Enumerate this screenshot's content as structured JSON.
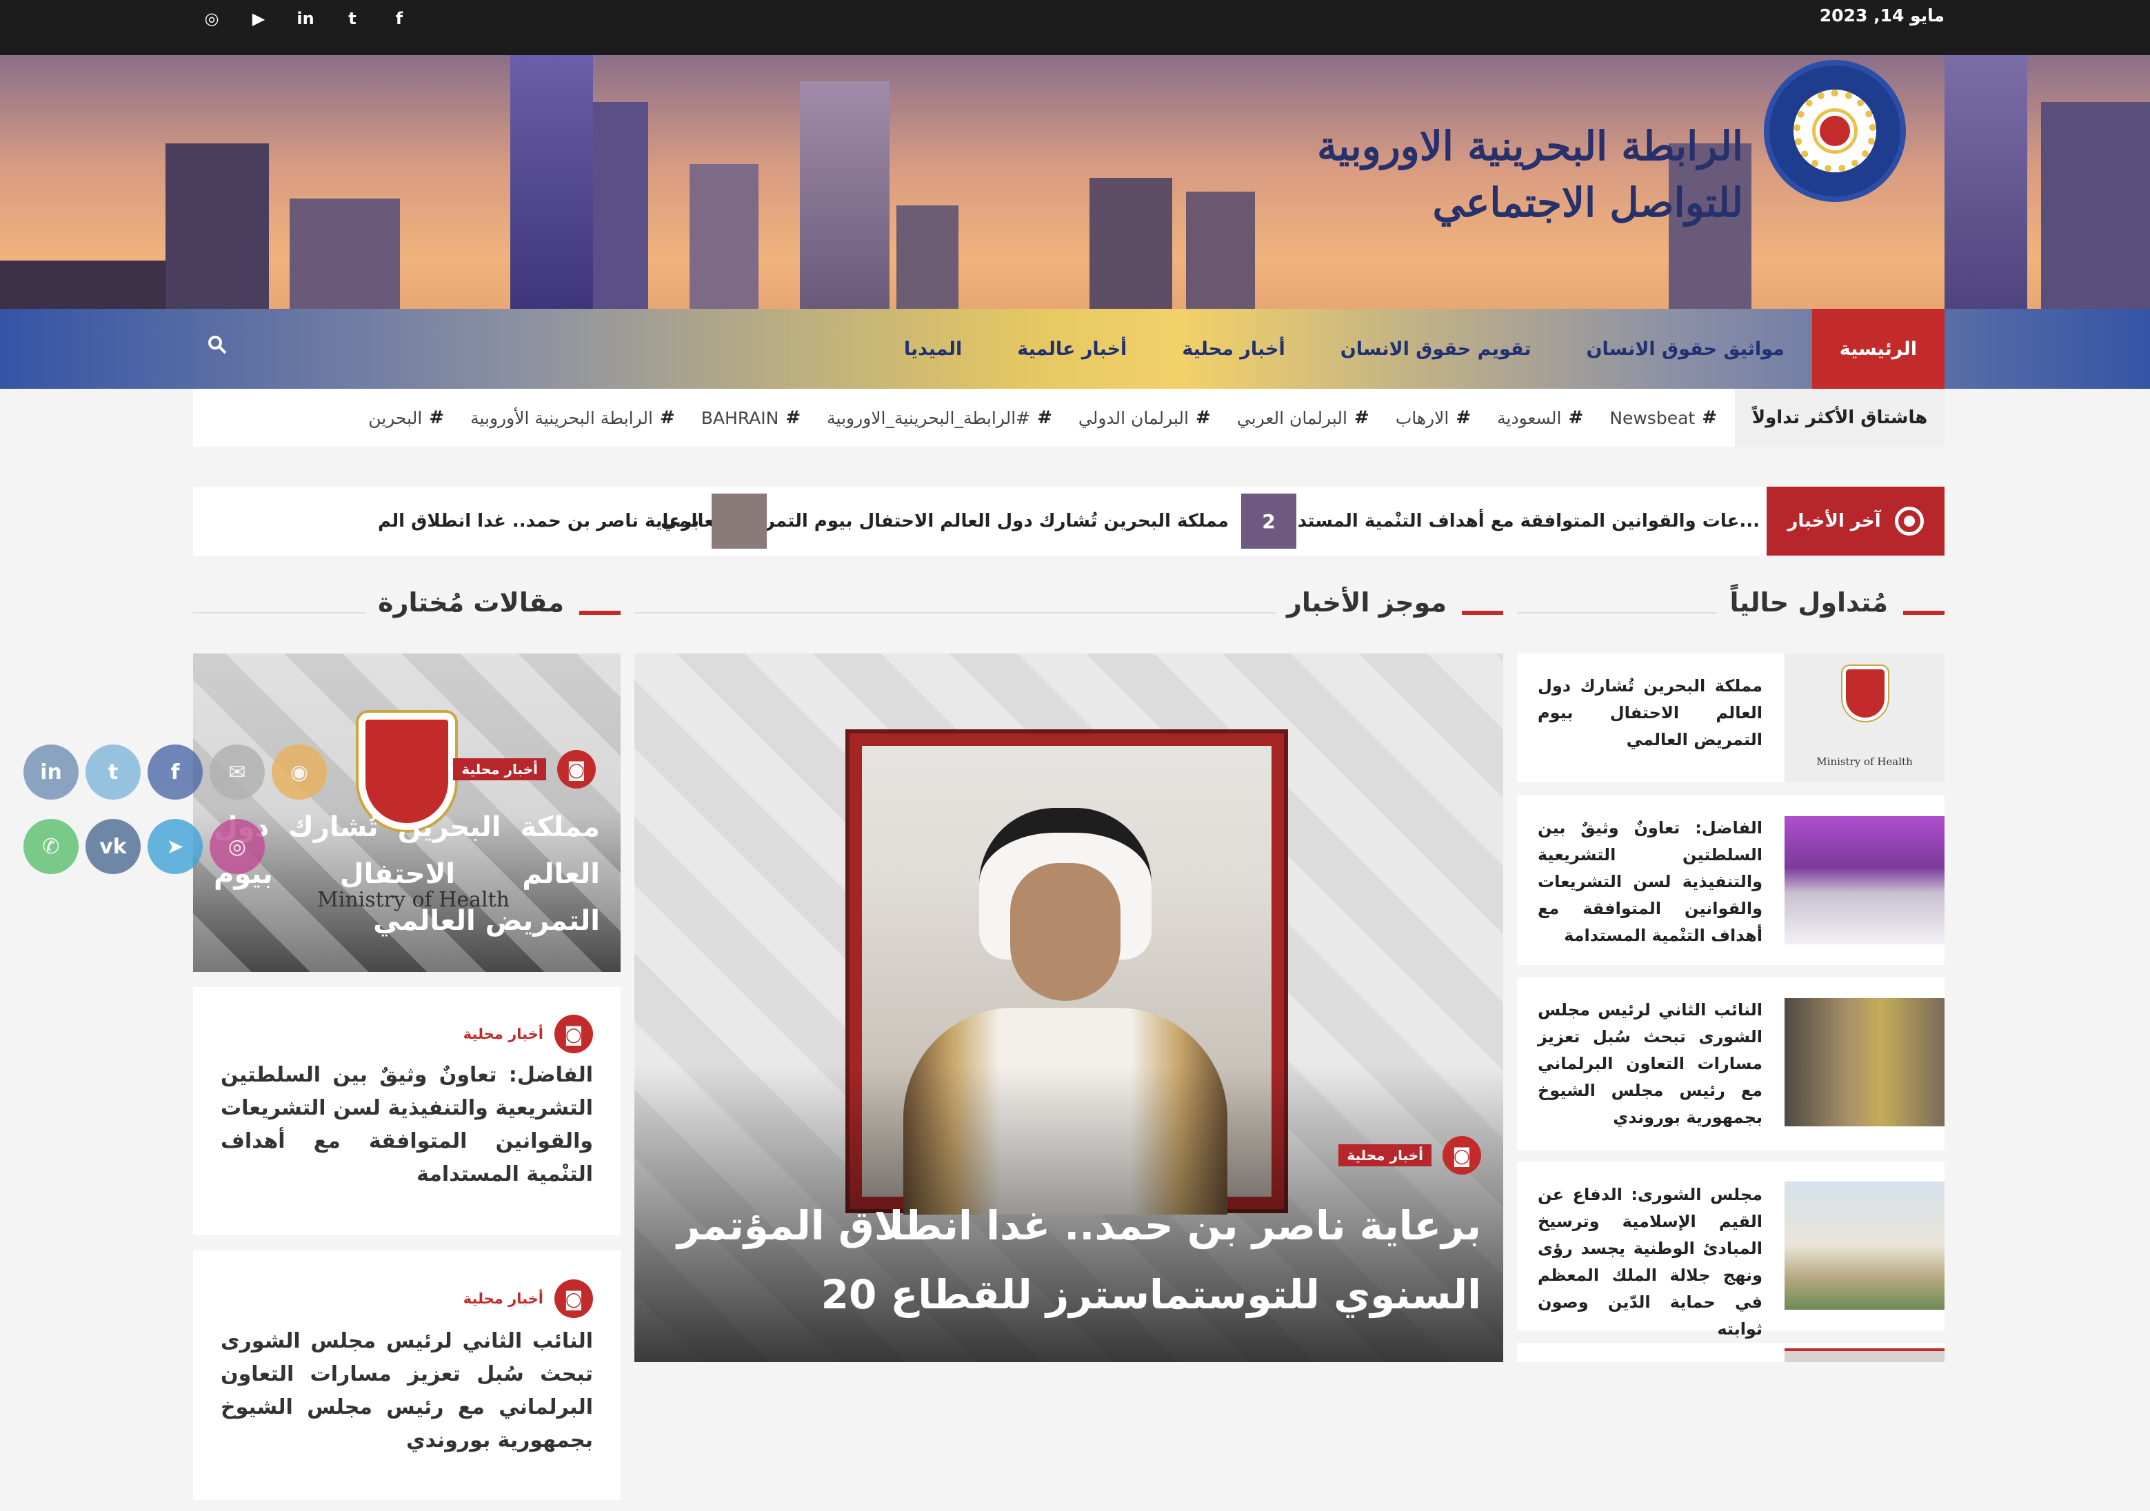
{
  "topbar": {
    "date": "مايو 14, 2023",
    "social": [
      {
        "name": "facebook-icon",
        "glyph": "f"
      },
      {
        "name": "twitter-icon",
        "glyph": "t"
      },
      {
        "name": "linkedin-icon",
        "glyph": "in"
      },
      {
        "name": "youtube-icon",
        "glyph": "▶"
      },
      {
        "name": "instagram-icon",
        "glyph": "◎"
      }
    ]
  },
  "brand": {
    "title_line1": "الرابطة البحرينية الاوروبية",
    "title_line2": "للتواصل الاجتماعي"
  },
  "nav": {
    "items": [
      {
        "label": "الرئيسية",
        "active": true
      },
      {
        "label": "مواثيق حقوق الانسان",
        "active": false
      },
      {
        "label": "تقويم حقوق الانسان",
        "active": false
      },
      {
        "label": "أخبار محلية",
        "active": false
      },
      {
        "label": "أخبار عالمية",
        "active": false
      },
      {
        "label": "الميديا",
        "active": false
      }
    ]
  },
  "hashtags": {
    "label": "هاشتاق الأكثر تداولاً",
    "items": [
      "البحرين",
      "الرابطة البحرينية الأوروبية",
      "BAHRAIN",
      "#الرابطة_البحرينية_الاوروبية",
      "البرلمان الدولي",
      "البرلمان العربي",
      "الارهاب",
      "السعودية",
      "Newsbeat"
    ]
  },
  "ticker": {
    "label": "آخر الأخبار",
    "items": [
      {
        "text": "...عات والقوانين المتوافقة مع أهداف التنْمية المستدامة",
        "badge": ""
      },
      {
        "text": "مملكة البحرين تُشارك دول العالم الاحتفال بيوم التمريض العالمي",
        "badge": "2"
      },
      {
        "text": "برعاية ناصر بن حمد.. غدا انطلاق الم",
        "badge": ""
      }
    ]
  },
  "sections": {
    "trending": "مُتداول حالياً",
    "brief": "موجز الأخبار",
    "featured": "مقالات مُختارة"
  },
  "trending": [
    {
      "text": "مملكة البحرين تُشارك دول العالم الاحتفال بيوم التمريض العالمي",
      "img_caption": "Ministry of Health"
    },
    {
      "text": "الفاضل: تعاونٌ وثيقٌ بين السلطتين التشريعية والتنفيذية لسن التشريعات والقوانين المتوافقة مع أهداف التنْمية المستدامة"
    },
    {
      "text": "النائب الثاني لرئيس مجلس الشورى تبحث سُبل تعزيز مسارات التعاون البرلماني مع رئيس مجلس الشيوخ بجمهورية بوروندي"
    },
    {
      "text": "مجلس الشورى: الدفاع عن القيم الإسلامية وترسيخ المبادئ الوطنية يجسد رؤى ونهج جلالة الملك المعظم في حماية الدّين وصون ثوابته"
    }
  ],
  "main": {
    "category": "أخبار محلية",
    "title": "برعاية ناصر بن حمد.. غدا انطلاق المؤتمر السنوي للتوستماسترز للقطاع 20"
  },
  "featured": [
    {
      "category": "أخبار محلية",
      "title": "مملكة البحرين تُشارك دول العالم الاحتفال بيوم التمريض العالمي",
      "img_caption": "Ministry of Health"
    },
    {
      "category": "أخبار محلية",
      "title": "الفاضل: تعاونٌ وثيقٌ بين السلطتين التشريعية والتنفيذية لسن التشريعات والقوانين المتوافقة مع أهداف التنْمية المستدامة"
    },
    {
      "category": "أخبار محلية",
      "title": "النائب الثاني لرئيس مجلس الشورى تبحث سُبل تعزيز مسارات التعاون البرلماني مع رئيس مجلس الشيوخ بجمهورية بوروندي"
    }
  ],
  "floating_social": [
    {
      "name": "linkedin-share-icon",
      "glyph": "in",
      "color": "#6f8fb5"
    },
    {
      "name": "twitter-share-icon",
      "glyph": "t",
      "color": "#7fb6dc"
    },
    {
      "name": "facebook-share-icon",
      "glyph": "f",
      "color": "#4e6aa8"
    },
    {
      "name": "email-share-icon",
      "glyph": "✉",
      "color": "#b0b0b0"
    },
    {
      "name": "rss-share-icon",
      "glyph": "◉",
      "color": "#e8b05a"
    },
    {
      "name": "whatsapp-share-icon",
      "glyph": "✆",
      "color": "#5bbf6e"
    },
    {
      "name": "vk-share-icon",
      "glyph": "vk",
      "color": "#4f6d94"
    },
    {
      "name": "telegram-share-icon",
      "glyph": "➤",
      "color": "#41a3d8"
    },
    {
      "name": "instagram-share-icon",
      "glyph": "◎",
      "color": "#c04a93"
    }
  ],
  "colors": {
    "accent": "#c32b2b",
    "nav_text": "#203072",
    "topbar": "#1c1c1c"
  }
}
